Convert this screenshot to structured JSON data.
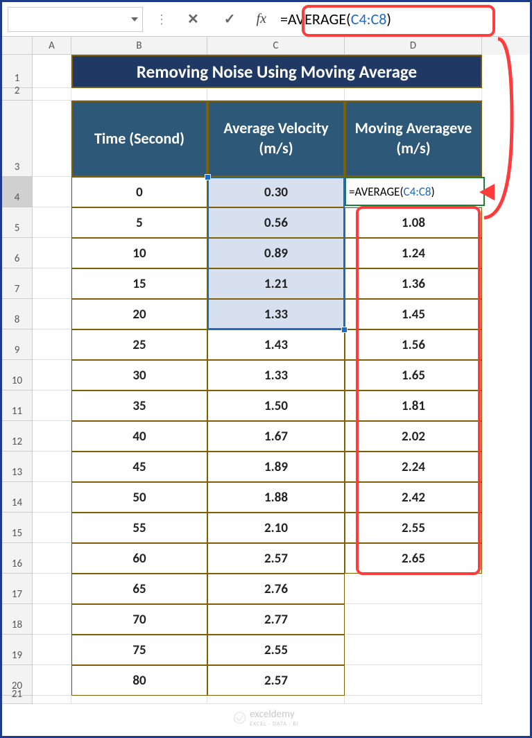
{
  "formula_bar": {
    "cancel_icon": "✕",
    "enter_icon": "✓",
    "fx": "fx",
    "formula_prefix": "=AVERAGE(",
    "formula_ref": "C4:C8",
    "formula_suffix": ")"
  },
  "columns": {
    "A": "A",
    "B": "B",
    "C": "C",
    "D": "D"
  },
  "row_nums": {
    "1": "1",
    "2": "2",
    "3": "3",
    "4": "4",
    "5": "5",
    "6": "6",
    "7": "7",
    "8": "8",
    "9": "9",
    "10": "10",
    "11": "11",
    "12": "12",
    "13": "13",
    "14": "14",
    "15": "15",
    "16": "16",
    "17": "17",
    "18": "18",
    "19": "19",
    "20": "20",
    "21": "21"
  },
  "title": "Removing Noise Using Moving Average",
  "headers": {
    "b": "Time (Second)",
    "c": "Average Velocity (m/s)",
    "d": "Moving Averageve (m/s)"
  },
  "edit_cell": {
    "prefix": "=AVERAGE(",
    "ref": "C4:C8",
    "suffix": ")"
  },
  "rows": [
    {
      "b": "0",
      "c": "0.30",
      "d": ""
    },
    {
      "b": "5",
      "c": "0.56",
      "d": "1.08"
    },
    {
      "b": "10",
      "c": "0.89",
      "d": "1.24"
    },
    {
      "b": "15",
      "c": "1.21",
      "d": "1.36"
    },
    {
      "b": "20",
      "c": "1.33",
      "d": "1.45"
    },
    {
      "b": "25",
      "c": "1.43",
      "d": "1.56"
    },
    {
      "b": "30",
      "c": "1.33",
      "d": "1.65"
    },
    {
      "b": "35",
      "c": "1.50",
      "d": "1.81"
    },
    {
      "b": "40",
      "c": "1.67",
      "d": "2.02"
    },
    {
      "b": "45",
      "c": "1.89",
      "d": "2.24"
    },
    {
      "b": "50",
      "c": "1.88",
      "d": "2.42"
    },
    {
      "b": "55",
      "c": "2.10",
      "d": "2.55"
    },
    {
      "b": "60",
      "c": "2.57",
      "d": "2.65"
    },
    {
      "b": "65",
      "c": "2.76",
      "d": ""
    },
    {
      "b": "70",
      "c": "2.77",
      "d": ""
    },
    {
      "b": "75",
      "c": "2.55",
      "d": ""
    },
    {
      "b": "80",
      "c": "2.57",
      "d": ""
    }
  ],
  "watermark": {
    "name": "exceldemy",
    "sub": "EXCEL · DATA · BI"
  },
  "chart_data": {
    "type": "table",
    "title": "Removing Noise Using Moving Average",
    "columns": [
      "Time (Second)",
      "Average Velocity (m/s)",
      "Moving Averageve (m/s)"
    ],
    "data": [
      [
        0,
        0.3,
        null
      ],
      [
        5,
        0.56,
        1.08
      ],
      [
        10,
        0.89,
        1.24
      ],
      [
        15,
        1.21,
        1.36
      ],
      [
        20,
        1.33,
        1.45
      ],
      [
        25,
        1.43,
        1.56
      ],
      [
        30,
        1.33,
        1.65
      ],
      [
        35,
        1.5,
        1.81
      ],
      [
        40,
        1.67,
        2.02
      ],
      [
        45,
        1.89,
        2.24
      ],
      [
        50,
        1.88,
        2.42
      ],
      [
        55,
        2.1,
        2.55
      ],
      [
        60,
        2.57,
        2.65
      ],
      [
        65,
        2.76,
        null
      ],
      [
        70,
        2.77,
        null
      ],
      [
        75,
        2.55,
        null
      ],
      [
        80,
        2.57,
        null
      ]
    ],
    "formula_in_D4": "=AVERAGE(C4:C8)"
  }
}
